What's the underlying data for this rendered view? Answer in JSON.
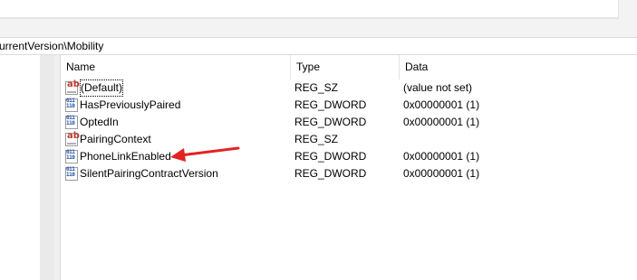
{
  "address": {
    "path": "urrentVersion\\Mobility"
  },
  "columns": {
    "name": "Name",
    "type": "Type",
    "data": "Data"
  },
  "values": [
    {
      "name": "(Default)",
      "type": "REG_SZ",
      "data": "(value not set)",
      "icon": "string-value-icon"
    },
    {
      "name": "HasPreviouslyPaired",
      "type": "REG_DWORD",
      "data": "0x00000001 (1)",
      "icon": "dword-value-icon"
    },
    {
      "name": "OptedIn",
      "type": "REG_DWORD",
      "data": "0x00000001 (1)",
      "icon": "dword-value-icon"
    },
    {
      "name": "PairingContext",
      "type": "REG_SZ",
      "data": "",
      "icon": "string-value-icon"
    },
    {
      "name": "PhoneLinkEnabled",
      "type": "REG_DWORD",
      "data": "0x00000001 (1)",
      "icon": "dword-value-icon"
    },
    {
      "name": "SilentPairingContractVersion",
      "type": "REG_DWORD",
      "data": "0x00000001 (1)",
      "icon": "dword-value-icon"
    }
  ],
  "annotation": {
    "color": "#e32222",
    "target": "PhoneLinkEnabled"
  }
}
